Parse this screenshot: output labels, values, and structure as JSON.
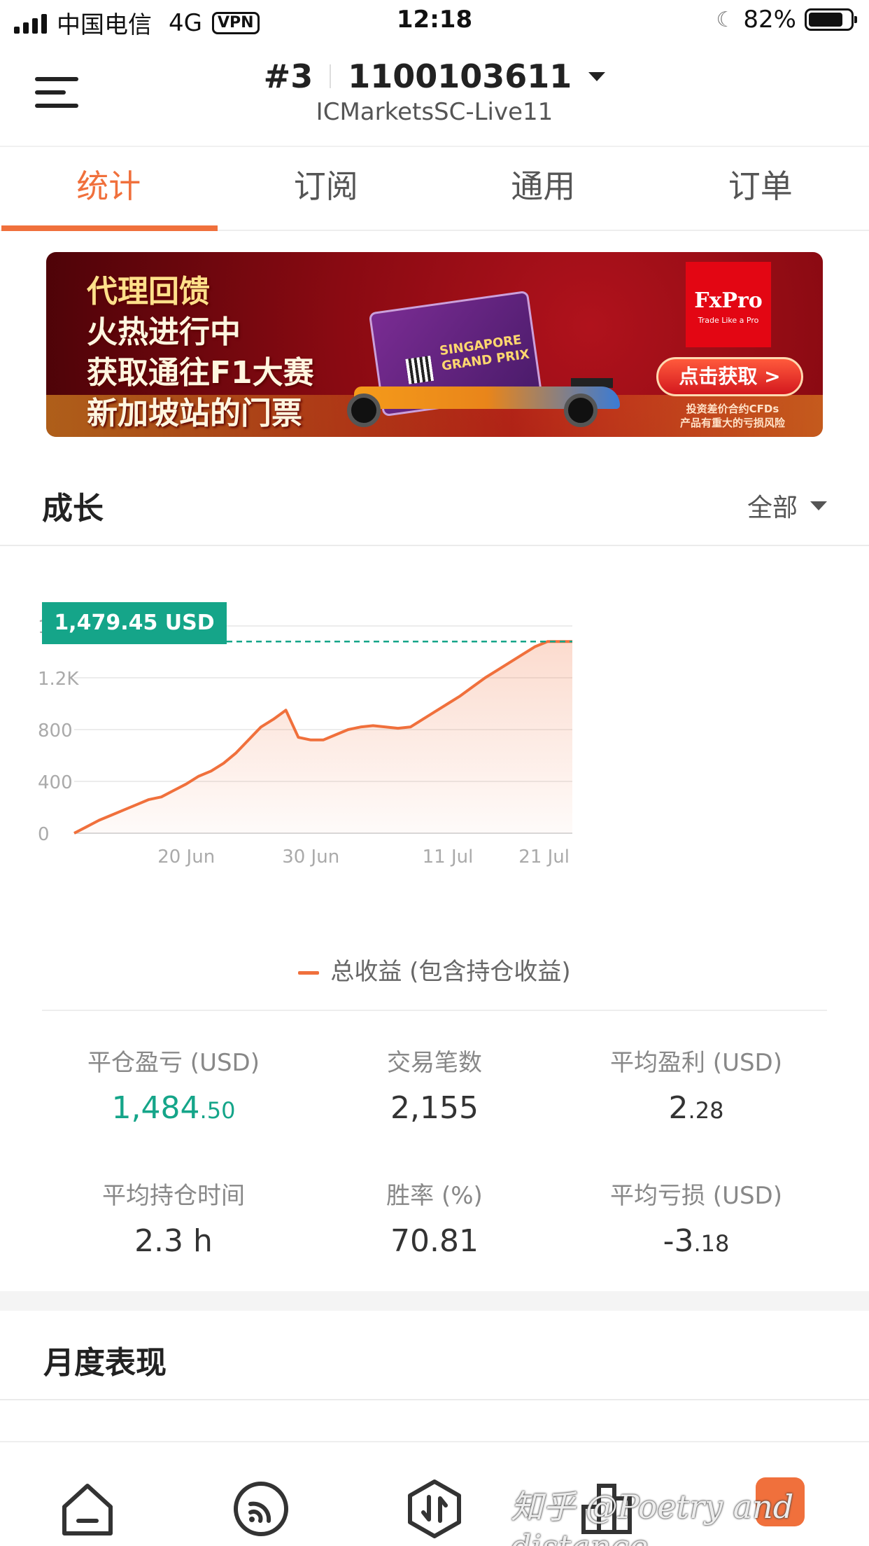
{
  "status_bar": {
    "carrier": "中国电信",
    "network": "4G",
    "vpn": "VPN",
    "time": "12:18",
    "battery": "82%",
    "battery_level": 0.82
  },
  "header": {
    "account_index": "#3",
    "account_number": "1100103611",
    "server": "ICMarketsSC-Live11"
  },
  "tabs": [
    {
      "label": "统计",
      "active": true
    },
    {
      "label": "订阅",
      "active": false
    },
    {
      "label": "通用",
      "active": false
    },
    {
      "label": "订单",
      "active": false
    }
  ],
  "banner": {
    "lines": [
      "代理回馈",
      "火热进行中",
      "获取通往F1大赛",
      "新加坡站的门票"
    ],
    "ticket_text": [
      "SINGAPORE",
      "GRAND PRIX"
    ],
    "brand": "FxPro",
    "brand_tagline": "Trade Like a Pro",
    "cta": "点击获取 >",
    "risk": [
      "投资差价合约CFDs",
      "产品有重大的亏损风险"
    ]
  },
  "growth": {
    "title": "成长",
    "filter": "全部",
    "current_value_label": "1,479.45 USD",
    "legend": "总收益 (包含持仓收益)"
  },
  "chart_data": {
    "type": "area",
    "x": [
      "Jun 11",
      "Jun 12",
      "Jun 13",
      "Jun 14",
      "Jun 15",
      "Jun 16",
      "Jun 17",
      "Jun 18",
      "Jun 19",
      "Jun 20",
      "Jun 21",
      "Jun 22",
      "Jun 23",
      "Jun 24",
      "Jun 25",
      "Jun 26",
      "Jun 27",
      "Jun 28",
      "Jun 29",
      "Jun 30",
      "Jul 01",
      "Jul 02",
      "Jul 03",
      "Jul 04",
      "Jul 05",
      "Jul 06",
      "Jul 07",
      "Jul 08",
      "Jul 09",
      "Jul 10",
      "Jul 11",
      "Jul 12",
      "Jul 13",
      "Jul 14",
      "Jul 15",
      "Jul 16",
      "Jul 17",
      "Jul 18",
      "Jul 19",
      "Jul 20",
      "Jul 21"
    ],
    "series": [
      {
        "name": "总收益 (包含持仓收益)",
        "values": [
          0,
          50,
          100,
          140,
          180,
          220,
          260,
          280,
          330,
          380,
          440,
          480,
          540,
          620,
          720,
          820,
          880,
          950,
          740,
          720,
          720,
          760,
          800,
          820,
          830,
          820,
          810,
          820,
          880,
          940,
          1000,
          1060,
          1130,
          1200,
          1260,
          1320,
          1380,
          1440,
          1479.45,
          1479.45,
          1479.45
        ]
      }
    ],
    "x_ticks": [
      "20 Jun",
      "30 Jun",
      "11 Jul",
      "21 Jul"
    ],
    "y_ticks": [
      "0",
      "400",
      "800",
      "1.2K",
      "1.6K"
    ],
    "ylim": [
      0,
      1600
    ],
    "grid": true,
    "color": "#f0703c",
    "reference_line_color": "#15a589"
  },
  "stats": [
    {
      "label": "平仓盈亏 (USD)",
      "int": "1,484",
      "frac": ".50",
      "highlight": true
    },
    {
      "label": "交易笔数",
      "int": "2,155",
      "frac": "",
      "highlight": false
    },
    {
      "label": "平均盈利 (USD)",
      "int": "2",
      "frac": ".28",
      "highlight": false
    },
    {
      "label": "平均持仓时间",
      "int": "2.3 h",
      "frac": "",
      "highlight": false
    },
    {
      "label": "胜率 (%)",
      "int": "70.81",
      "frac": "",
      "highlight": false
    },
    {
      "label": "平均亏损 (USD)",
      "int": "-3",
      "frac": ".18",
      "highlight": false
    }
  ],
  "monthly": {
    "title": "月度表现"
  },
  "bottom_nav": {
    "items": [
      {
        "icon": "home-icon"
      },
      {
        "icon": "signal-feed-icon"
      },
      {
        "icon": "trade-icon"
      },
      {
        "icon": "chart-icon"
      },
      {
        "icon": "profile-icon"
      }
    ],
    "watermark": "知乎 @Poetry and distance"
  }
}
